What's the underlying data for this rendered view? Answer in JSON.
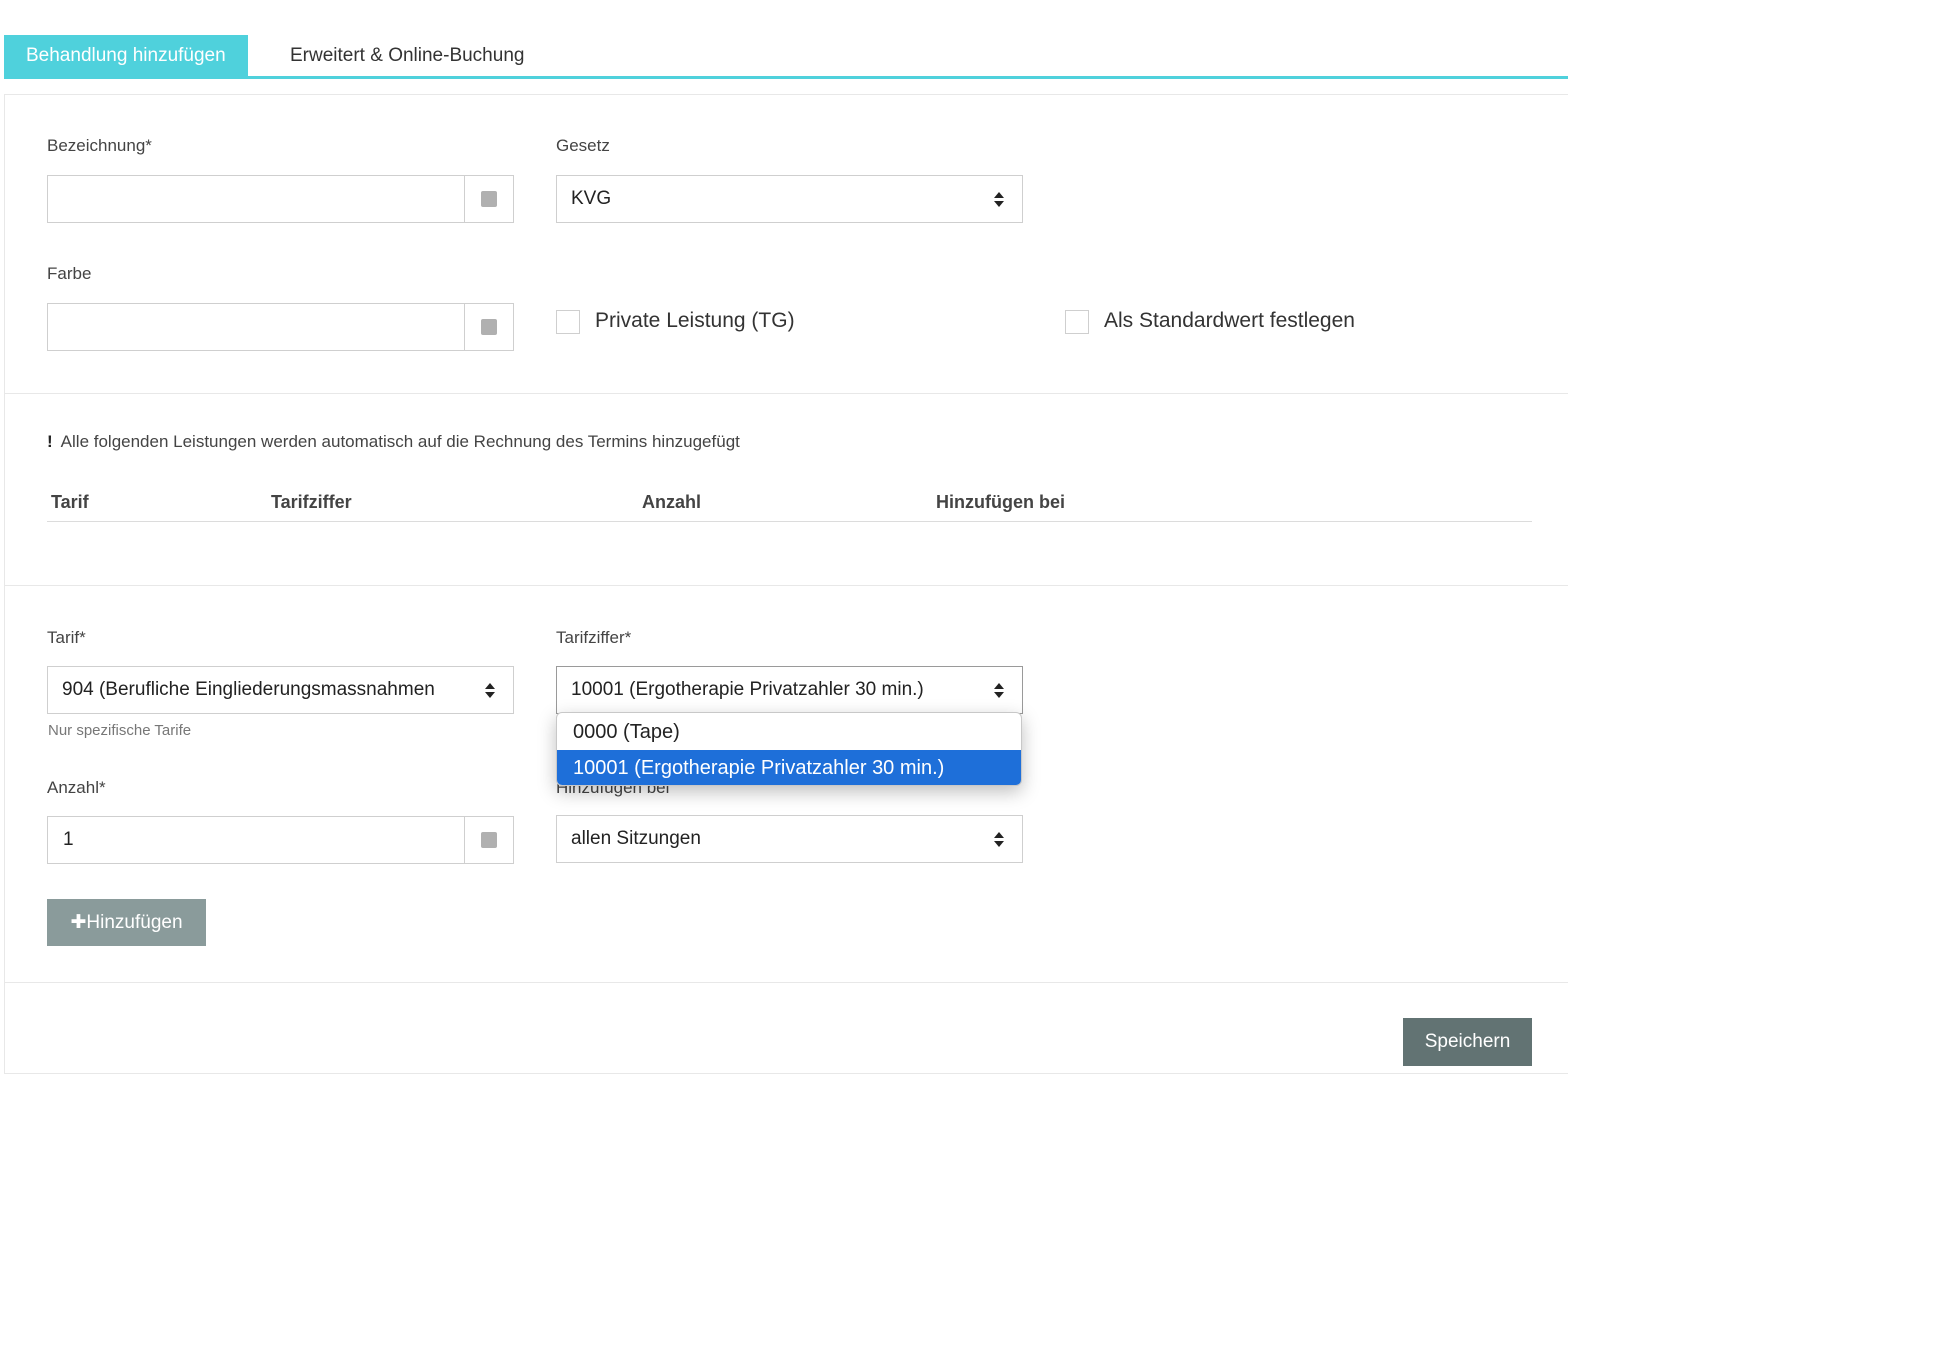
{
  "tabs": [
    "Behandlung hinzufügen",
    "Erweitert & Online-Buchung"
  ],
  "form1": {
    "bezeichnung_label": "Bezeichnung*",
    "bezeichnung_value": "",
    "gesetz_label": "Gesetz",
    "gesetz_value": "KVG",
    "farbe_label": "Farbe",
    "farbe_value": "",
    "private_label": "Private Leistung (TG)",
    "standard_label": "Als Standardwert festlegen"
  },
  "notice": "Alle folgenden Leistungen werden automatisch auf die Rechnung des Termins hinzugefügt",
  "table": {
    "headers": [
      "Tarif",
      "Tarifziffer",
      "Anzahl",
      "Hinzufügen bei"
    ]
  },
  "form2": {
    "tarif_label": "Tarif*",
    "tarif_value": "904 (Berufliche Eingliederungsmassnahmen",
    "tarif_hint": "Nur spezifische Tarife",
    "tarifziffer_label": "Tarifziffer*",
    "tarifziffer_value": "10001 (Ergotherapie Privatzahler 30 min.)",
    "tarifziffer_options": [
      "0000 (Tape)",
      "10001 (Ergotherapie Privatzahler 30 min.)"
    ],
    "anzahl_label": "Anzahl*",
    "anzahl_value": "1",
    "hinzufuegen_bei_label": "Hinzufügen bei",
    "hinzufuegen_bei_value": "allen Sitzungen",
    "add_button": "Hinzufügen"
  },
  "save_button": "Speichern",
  "colors": {
    "accent": "#4fd1dc",
    "selected_option": "#1e6fd9",
    "add_button": "#8a9b9b",
    "save_button": "#627373"
  }
}
